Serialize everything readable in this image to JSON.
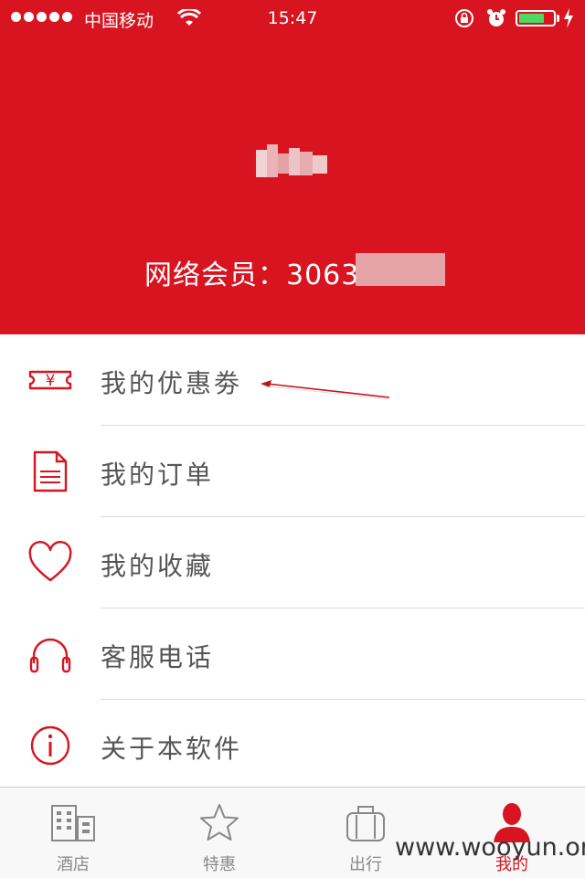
{
  "status_bar": {
    "carrier": "中国移动",
    "time": "15:47",
    "battery_percent": 75,
    "icons": [
      "signal-dots-icon",
      "wifi-icon",
      "rotation-lock-icon",
      "alarm-icon",
      "battery-icon",
      "charging-bolt-icon"
    ]
  },
  "profile": {
    "member_label": "网络会员：3063"
  },
  "menu": {
    "items": [
      {
        "label": "我的优惠劵",
        "icon": "coupon-ticket-icon"
      },
      {
        "label": "我的订单",
        "icon": "document-icon"
      },
      {
        "label": "我的收藏",
        "icon": "heart-icon"
      },
      {
        "label": "客服电话",
        "icon": "headphones-icon"
      },
      {
        "label": "关于本软件",
        "icon": "info-icon"
      }
    ]
  },
  "tabbar": {
    "tabs": [
      {
        "label": "酒店",
        "icon": "hotel-building-icon"
      },
      {
        "label": "特惠",
        "icon": "star-icon"
      },
      {
        "label": "出行",
        "icon": "luggage-icon"
      },
      {
        "label": "我的",
        "icon": "user-silhouette-icon",
        "active": true
      }
    ]
  },
  "watermark": "www.wooyun.org",
  "colors": {
    "brand_red": "#d7141f",
    "text_gray": "#555555",
    "tab_gray": "#888888"
  }
}
